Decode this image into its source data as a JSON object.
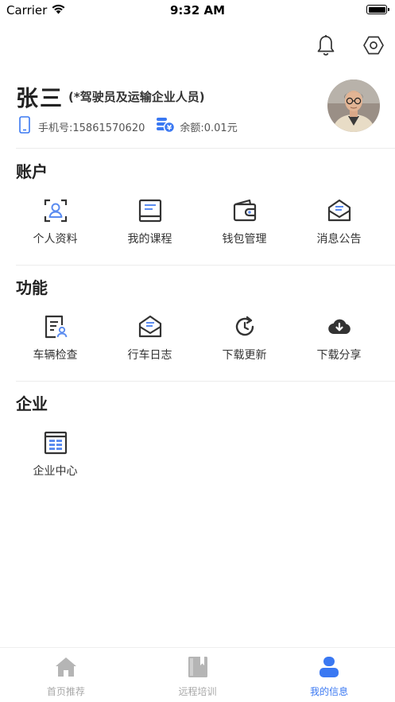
{
  "status_bar": {
    "carrier": "Carrier",
    "time": "9:32 AM"
  },
  "profile": {
    "name": "张三",
    "role": "(*驾驶员及运输企业人员)",
    "phone_label": "手机号:15861570620",
    "balance_label": "余额:0.01元"
  },
  "sections": {
    "account": {
      "title": "账户",
      "items": [
        {
          "label": "个人资料",
          "icon": "profile-card-icon"
        },
        {
          "label": "我的课程",
          "icon": "course-book-icon"
        },
        {
          "label": "钱包管理",
          "icon": "wallet-icon"
        },
        {
          "label": "消息公告",
          "icon": "message-mail-icon"
        }
      ]
    },
    "functions": {
      "title": "功能",
      "items": [
        {
          "label": "车辆检查",
          "icon": "vehicle-check-icon"
        },
        {
          "label": "行车日志",
          "icon": "driving-log-icon"
        },
        {
          "label": "下载更新",
          "icon": "refresh-clock-icon"
        },
        {
          "label": "下载分享",
          "icon": "cloud-download-icon"
        }
      ]
    },
    "enterprise": {
      "title": "企业",
      "items": [
        {
          "label": "企业中心",
          "icon": "building-icon"
        }
      ]
    }
  },
  "tabbar": {
    "items": [
      {
        "label": "首页推荐",
        "icon": "home-icon",
        "active": false
      },
      {
        "label": "远程培训",
        "icon": "book-icon",
        "active": false
      },
      {
        "label": "我的信息",
        "icon": "user-icon",
        "active": true
      }
    ]
  },
  "colors": {
    "accent": "#3a78f2",
    "icon_dark": "#333333",
    "icon_blue": "#5b8cf0",
    "tab_inactive": "#b5b5b5"
  }
}
